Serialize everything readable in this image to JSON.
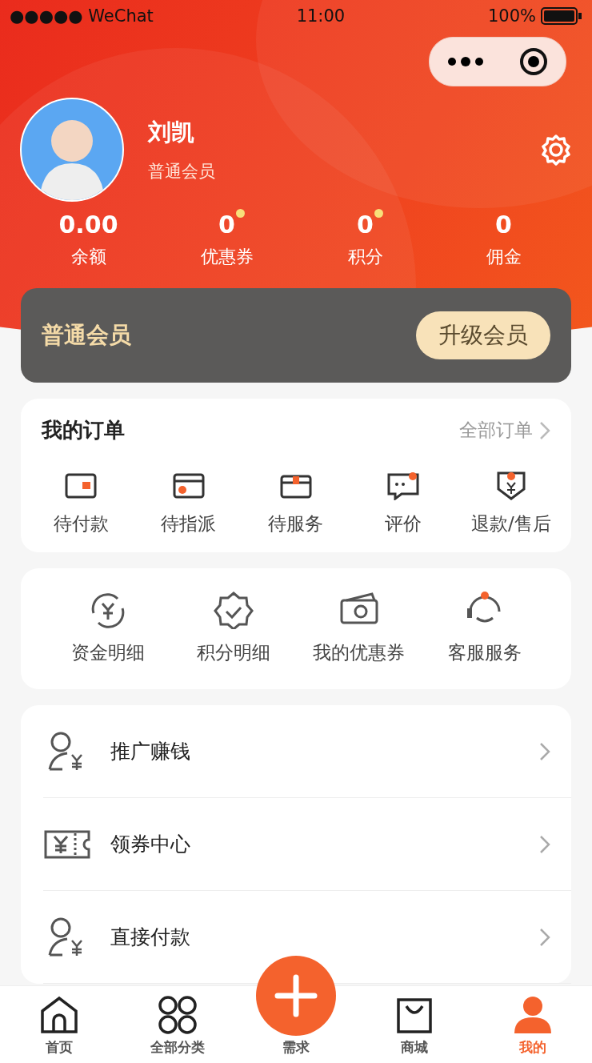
{
  "status_bar": {
    "carrier": "●●●●● WeChat",
    "time": "11:00",
    "battery": "100%"
  },
  "profile": {
    "name": "刘凯",
    "level": "普通会员"
  },
  "stats": [
    {
      "value": "0.00",
      "label": "余额",
      "dot": false
    },
    {
      "value": "0",
      "label": "优惠券",
      "dot": true
    },
    {
      "value": "0",
      "label": "积分",
      "dot": true
    },
    {
      "value": "0",
      "label": "佣金",
      "dot": false
    }
  ],
  "member_card": {
    "title": "普通会员",
    "button": "升级会员"
  },
  "orders": {
    "title": "我的订单",
    "link": "全部订单",
    "items": [
      {
        "kind": "wallet",
        "label": "待付款"
      },
      {
        "kind": "card",
        "label": "待指派"
      },
      {
        "kind": "box",
        "label": "待服务"
      },
      {
        "kind": "chat",
        "label": "评价"
      },
      {
        "kind": "refund",
        "label": "退款/售后"
      }
    ]
  },
  "tools": [
    {
      "kind": "fund",
      "label": "资金明细"
    },
    {
      "kind": "badge",
      "label": "积分明细"
    },
    {
      "kind": "ticket",
      "label": "我的优惠券"
    },
    {
      "kind": "service",
      "label": "客服服务"
    }
  ],
  "menu": [
    {
      "kind": "person",
      "label": "推广赚钱"
    },
    {
      "kind": "coupon",
      "label": "领券中心"
    },
    {
      "kind": "person",
      "label": "直接付款"
    }
  ],
  "tab_bar": [
    {
      "kind": "home",
      "label": "首页",
      "selected": false
    },
    {
      "kind": "grid",
      "label": "全部分类",
      "selected": false
    },
    {
      "kind": "plus",
      "label": "需求",
      "selected": false
    },
    {
      "kind": "bag",
      "label": "商城",
      "selected": false
    },
    {
      "kind": "user",
      "label": "我的",
      "selected": true
    }
  ]
}
